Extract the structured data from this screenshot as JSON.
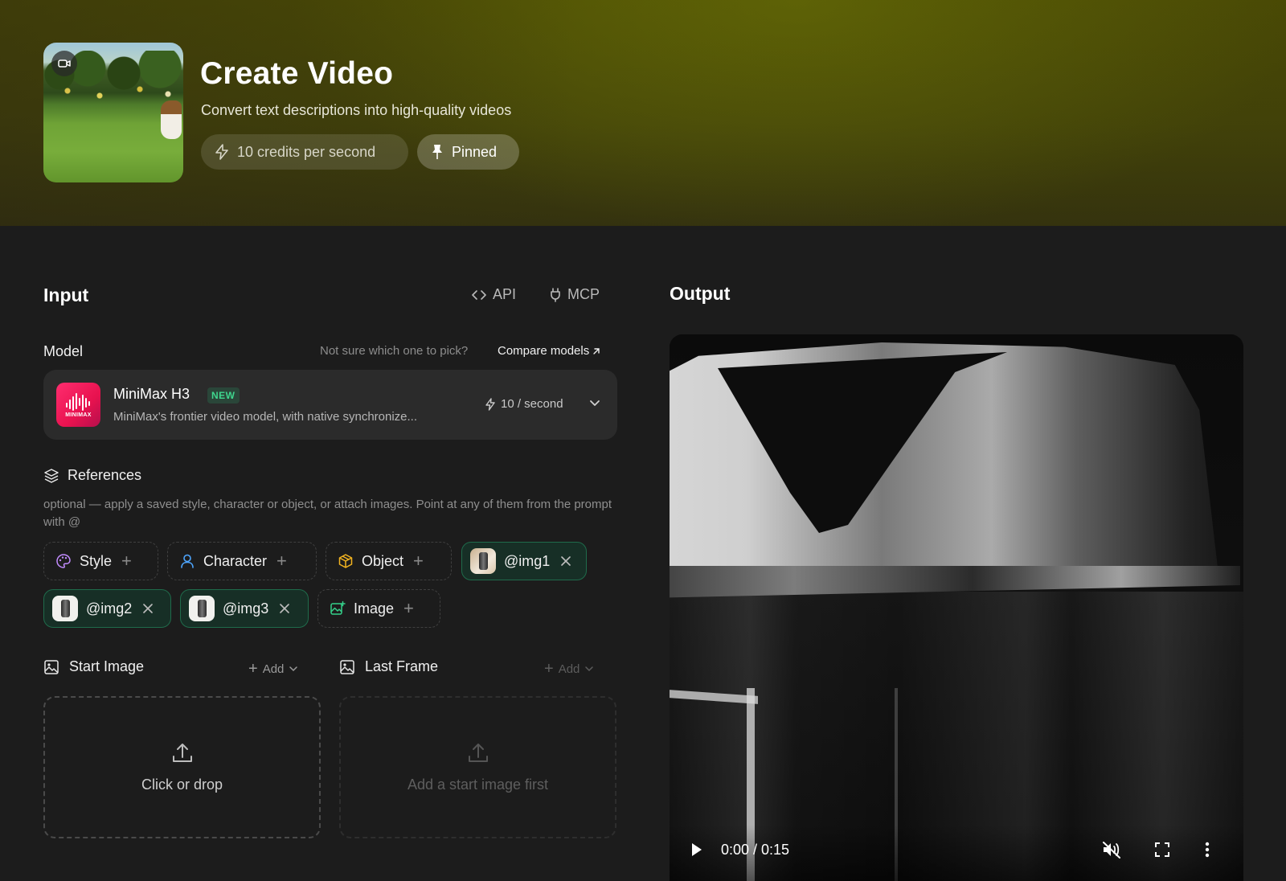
{
  "hero": {
    "title": "Create Video",
    "subtitle": "Convert text descriptions into high-quality videos",
    "credits_label": "10 credits per second",
    "pinned_label": "Pinned",
    "thumb_icon": "video-camera-icon"
  },
  "input": {
    "title": "Input",
    "api_label": "API",
    "mcp_label": "MCP",
    "model_label": "Model",
    "hint": "Not sure which one to pick?",
    "compare_label": "Compare models",
    "model": {
      "name": "MiniMax H3",
      "badge": "NEW",
      "logo_text": "MINIMAX",
      "description": "MiniMax's frontier video model, with native synchronize...",
      "rate": "10 / second"
    },
    "references": {
      "title": "References",
      "description": "optional — apply a saved style, character or object, or attach images. Point at any of them from the prompt with @",
      "chips": [
        {
          "label": "Style",
          "icon": "palette-icon"
        },
        {
          "label": "Character",
          "icon": "user-icon"
        },
        {
          "label": "Object",
          "icon": "box-icon"
        },
        {
          "label": "@img1"
        },
        {
          "label": "@img2"
        },
        {
          "label": "@img3"
        },
        {
          "label": "Image",
          "icon": "image-add-icon"
        }
      ]
    },
    "start_image": {
      "title": "Start Image",
      "add_label": "Add",
      "drop_text": "Click or drop"
    },
    "last_frame": {
      "title": "Last Frame",
      "add_label": "Add",
      "drop_text": "Add a start image first"
    }
  },
  "output": {
    "title": "Output",
    "video": {
      "time": "0:00 / 0:15",
      "muted": true
    }
  },
  "colors": {
    "accent_green": "#3fd68e",
    "hero_olive": "#4a4a05",
    "background": "#1c1c1c",
    "minimax_pink": "#ff2d6f"
  }
}
